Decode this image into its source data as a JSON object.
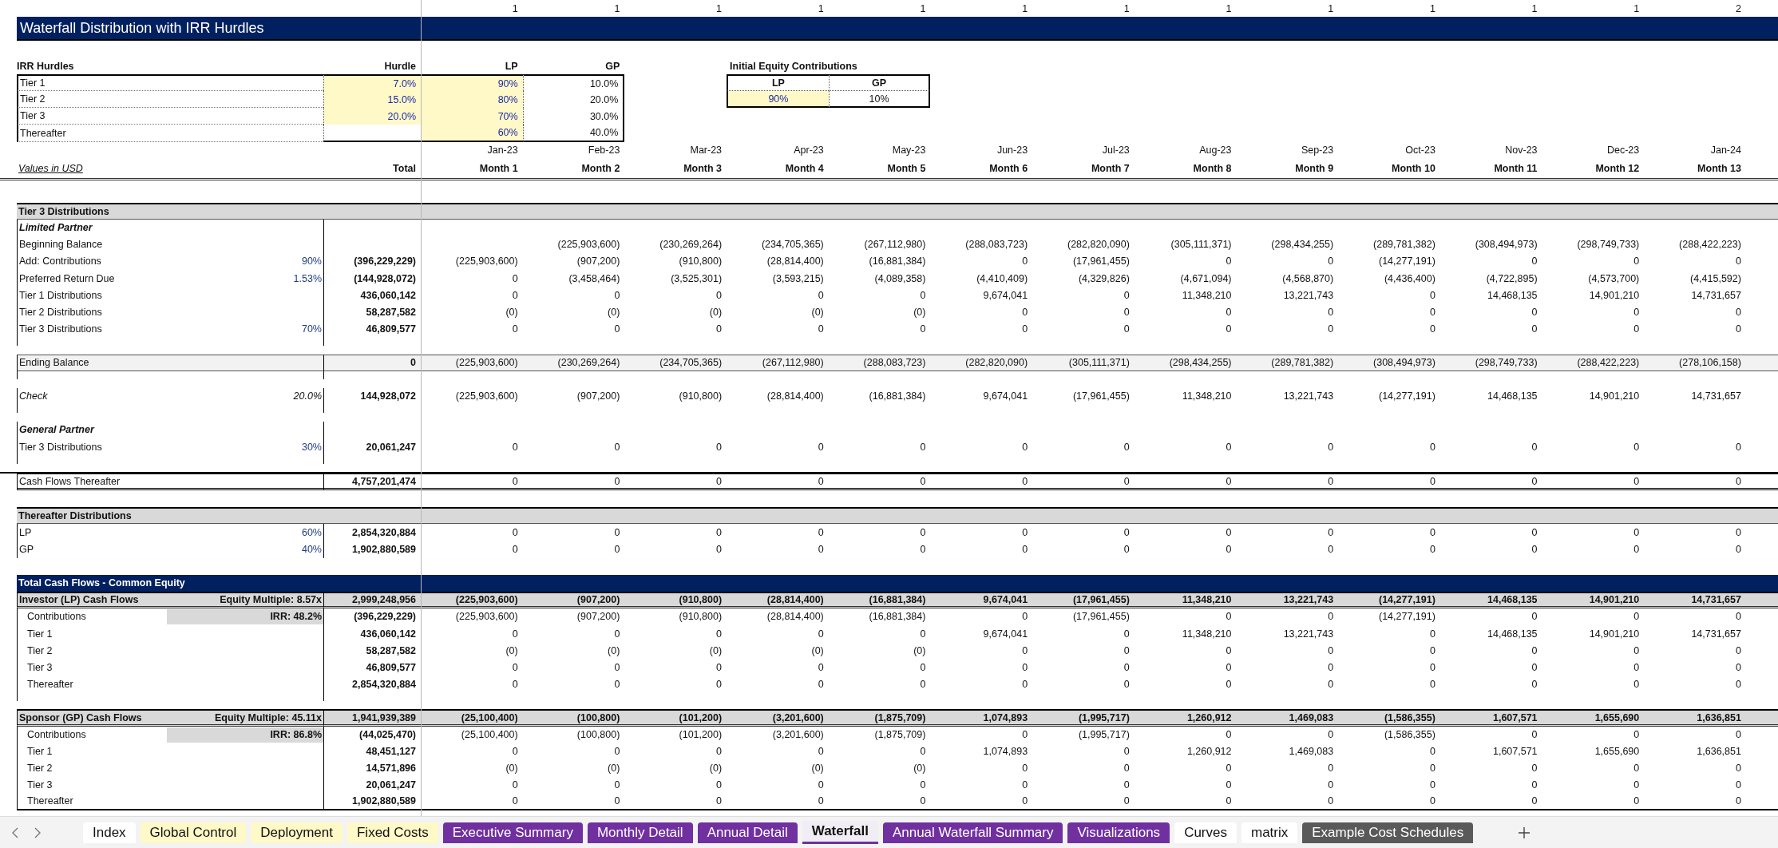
{
  "counters": [
    "1",
    "1",
    "1",
    "1",
    "1",
    "1",
    "1",
    "1",
    "1",
    "1",
    "1",
    "1",
    "2"
  ],
  "title": "Waterfall Distribution with IRR Hurdles",
  "irr_hurdles": {
    "heading": "IRR Hurdles",
    "hurdle_label": "Hurdle",
    "lp_label": "LP",
    "gp_label": "GP",
    "rows": [
      {
        "label": "Tier 1",
        "hurdle": "7.0%",
        "lp": "90%",
        "gp": "10.0%"
      },
      {
        "label": "Tier 2",
        "hurdle": "15.0%",
        "lp": "80%",
        "gp": "20.0%"
      },
      {
        "label": "Tier 3",
        "hurdle": "20.0%",
        "lp": "70%",
        "gp": "30.0%"
      },
      {
        "label": "Thereafter",
        "lp": "60%",
        "gp": "40.0%"
      }
    ]
  },
  "initial_equity": {
    "title": "Initial Equity Contributions",
    "lp_label": "LP",
    "gp_label": "GP",
    "lp": "90%",
    "gp": "10%"
  },
  "dates": [
    "Jan-23",
    "Feb-23",
    "Mar-23",
    "Apr-23",
    "May-23",
    "Jun-23",
    "Jul-23",
    "Aug-23",
    "Sep-23",
    "Oct-23",
    "Nov-23",
    "Dec-23",
    "Jan-24"
  ],
  "units_label": "Values in USD",
  "total_label": "Total",
  "months": [
    "Month 1",
    "Month 2",
    "Month 3",
    "Month 4",
    "Month 5",
    "Month 6",
    "Month 7",
    "Month 8",
    "Month 9",
    "Month 10",
    "Month 11",
    "Month 12",
    "Month 13"
  ],
  "rows": [
    {
      "kind": "section",
      "label": "Tier 3 Distributions"
    },
    {
      "kind": "subhead",
      "label": "Limited Partner"
    },
    {
      "kind": "opening",
      "label": "Beginning Balance",
      "values": [
        "(225,903,600)",
        "(230,269,264)",
        "(234,705,365)",
        "(267,112,980)",
        "(288,083,723)",
        "(282,820,090)",
        "(305,111,371)",
        "(298,434,255)",
        "(289,781,382)",
        "(308,494,973)",
        "(298,749,733)",
        "(288,422,223)"
      ]
    },
    {
      "kind": "line",
      "label": "Add: Contributions",
      "rate": "90%",
      "total": "(396,229,229)",
      "values": [
        "(225,903,600)",
        "(907,200)",
        "(910,800)",
        "(28,814,400)",
        "(16,881,384)",
        "0",
        "(17,961,455)",
        "0",
        "0",
        "(14,277,191)",
        "0",
        "0",
        "0"
      ]
    },
    {
      "kind": "line",
      "label": "Preferred Return Due",
      "rate": "1.53%",
      "total": "(144,928,072)",
      "values": [
        "0",
        "(3,458,464)",
        "(3,525,301)",
        "(3,593,215)",
        "(4,089,358)",
        "(4,410,409)",
        "(4,329,826)",
        "(4,671,094)",
        "(4,568,870)",
        "(4,436,400)",
        "(4,722,895)",
        "(4,573,700)",
        "(4,415,592)"
      ]
    },
    {
      "kind": "line",
      "label": "Tier 1 Distributions",
      "total": "436,060,142",
      "values": [
        "0",
        "0",
        "0",
        "0",
        "0",
        "9,674,041",
        "0",
        "11,348,210",
        "13,221,743",
        "0",
        "14,468,135",
        "14,901,210",
        "14,731,657"
      ]
    },
    {
      "kind": "line",
      "label": "Tier 2 Distributions",
      "total": "58,287,582",
      "values": [
        "(0)",
        "(0)",
        "(0)",
        "(0)",
        "(0)",
        "0",
        "0",
        "0",
        "0",
        "0",
        "0",
        "0",
        "0"
      ]
    },
    {
      "kind": "line",
      "label": "Tier 3 Distributions",
      "rate": "70%",
      "total": "46,809,577",
      "values": [
        "0",
        "0",
        "0",
        "0",
        "0",
        "0",
        "0",
        "0",
        "0",
        "0",
        "0",
        "0",
        "0"
      ]
    },
    {
      "kind": "spacer"
    },
    {
      "kind": "ending",
      "label": "Ending Balance",
      "total": "0",
      "values": [
        "(225,903,600)",
        "(230,269,264)",
        "(234,705,365)",
        "(267,112,980)",
        "(288,083,723)",
        "(282,820,090)",
        "(305,111,371)",
        "(298,434,255)",
        "(289,781,382)",
        "(308,494,973)",
        "(298,749,733)",
        "(288,422,223)",
        "(278,106,158)"
      ]
    },
    {
      "kind": "spacer"
    },
    {
      "kind": "check",
      "label": "Check",
      "rate": "20.0%",
      "total": "144,928,072",
      "values": [
        "(225,903,600)",
        "(907,200)",
        "(910,800)",
        "(28,814,400)",
        "(16,881,384)",
        "9,674,041",
        "(17,961,455)",
        "11,348,210",
        "13,221,743",
        "(14,277,191)",
        "14,468,135",
        "14,901,210",
        "14,731,657"
      ]
    },
    {
      "kind": "spacer"
    },
    {
      "kind": "subhead",
      "label": "General Partner"
    },
    {
      "kind": "line",
      "label": "Tier 3 Distributions",
      "rate": "30%",
      "total": "20,061,247",
      "values": [
        "0",
        "0",
        "0",
        "0",
        "0",
        "0",
        "0",
        "0",
        "0",
        "0",
        "0",
        "0",
        "0"
      ]
    },
    {
      "kind": "rule"
    },
    {
      "kind": "boxed",
      "label": "Cash Flows Thereafter",
      "total": "4,757,201,474",
      "values": [
        "0",
        "0",
        "0",
        "0",
        "0",
        "0",
        "0",
        "0",
        "0",
        "0",
        "0",
        "0",
        "0"
      ]
    },
    {
      "kind": "gap"
    },
    {
      "kind": "section",
      "label": "Thereafter Distributions"
    },
    {
      "kind": "line",
      "label": "LP",
      "rate": "60%",
      "total": "2,854,320,884",
      "values": [
        "0",
        "0",
        "0",
        "0",
        "0",
        "0",
        "0",
        "0",
        "0",
        "0",
        "0",
        "0",
        "0"
      ]
    },
    {
      "kind": "line",
      "label": "GP",
      "rate": "40%",
      "total": "1,902,880,589",
      "values": [
        "0",
        "0",
        "0",
        "0",
        "0",
        "0",
        "0",
        "0",
        "0",
        "0",
        "0",
        "0",
        "0"
      ]
    },
    {
      "kind": "gap"
    },
    {
      "kind": "banner",
      "label": "Total Cash Flows - Common Equity"
    },
    {
      "kind": "summary",
      "label": "Investor (LP) Cash Flows",
      "rate": "Equity Multiple: 8.57x",
      "total": "2,999,248,956",
      "values": [
        "(225,903,600)",
        "(907,200)",
        "(910,800)",
        "(28,814,400)",
        "(16,881,384)",
        "9,674,041",
        "(17,961,455)",
        "11,348,210",
        "13,221,743",
        "(14,277,191)",
        "14,468,135",
        "14,901,210",
        "14,731,657"
      ]
    },
    {
      "kind": "detail",
      "label": "Contributions",
      "rate": "IRR: 48.2%",
      "total": "(396,229,229)",
      "values": [
        "(225,903,600)",
        "(907,200)",
        "(910,800)",
        "(28,814,400)",
        "(16,881,384)",
        "0",
        "(17,961,455)",
        "0",
        "0",
        "(14,277,191)",
        "0",
        "0",
        "0"
      ]
    },
    {
      "kind": "detail",
      "label": "Tier 1",
      "total": "436,060,142",
      "values": [
        "0",
        "0",
        "0",
        "0",
        "0",
        "9,674,041",
        "0",
        "11,348,210",
        "13,221,743",
        "0",
        "14,468,135",
        "14,901,210",
        "14,731,657"
      ]
    },
    {
      "kind": "detail",
      "label": "Tier 2",
      "total": "58,287,582",
      "values": [
        "(0)",
        "(0)",
        "(0)",
        "(0)",
        "(0)",
        "0",
        "0",
        "0",
        "0",
        "0",
        "0",
        "0",
        "0"
      ]
    },
    {
      "kind": "detail",
      "label": "Tier 3",
      "total": "46,809,577",
      "values": [
        "0",
        "0",
        "0",
        "0",
        "0",
        "0",
        "0",
        "0",
        "0",
        "0",
        "0",
        "0",
        "0"
      ]
    },
    {
      "kind": "detail",
      "label": "Thereafter",
      "total": "2,854,320,884",
      "values": [
        "0",
        "0",
        "0",
        "0",
        "0",
        "0",
        "0",
        "0",
        "0",
        "0",
        "0",
        "0",
        "0"
      ]
    },
    {
      "kind": "spacer"
    },
    {
      "kind": "summary",
      "label": "Sponsor (GP) Cash Flows",
      "rate": "Equity Multiple: 45.11x",
      "total": "1,941,939,389",
      "values": [
        "(25,100,400)",
        "(100,800)",
        "(101,200)",
        "(3,201,600)",
        "(1,875,709)",
        "1,074,893",
        "(1,995,717)",
        "1,260,912",
        "1,469,083",
        "(1,586,355)",
        "1,607,571",
        "1,655,690",
        "1,636,851"
      ]
    },
    {
      "kind": "detail",
      "label": "Contributions",
      "rate": "IRR: 86.8%",
      "total": "(44,025,470)",
      "values": [
        "(25,100,400)",
        "(100,800)",
        "(101,200)",
        "(3,201,600)",
        "(1,875,709)",
        "0",
        "(1,995,717)",
        "0",
        "0",
        "(1,586,355)",
        "0",
        "0",
        "0"
      ]
    },
    {
      "kind": "detail",
      "label": "Tier 1",
      "total": "48,451,127",
      "values": [
        "0",
        "0",
        "0",
        "0",
        "0",
        "1,074,893",
        "0",
        "1,260,912",
        "1,469,083",
        "0",
        "1,607,571",
        "1,655,690",
        "1,636,851"
      ]
    },
    {
      "kind": "detail",
      "label": "Tier 2",
      "total": "14,571,896",
      "values": [
        "(0)",
        "(0)",
        "(0)",
        "(0)",
        "(0)",
        "0",
        "0",
        "0",
        "0",
        "0",
        "0",
        "0",
        "0"
      ]
    },
    {
      "kind": "detail",
      "label": "Tier 3",
      "total": "20,061,247",
      "values": [
        "0",
        "0",
        "0",
        "0",
        "0",
        "0",
        "0",
        "0",
        "0",
        "0",
        "0",
        "0",
        "0"
      ]
    },
    {
      "kind": "detail",
      "label": "Thereafter",
      "total": "1,902,880,589",
      "values": [
        "0",
        "0",
        "0",
        "0",
        "0",
        "0",
        "0",
        "0",
        "0",
        "0",
        "0",
        "0",
        "0"
      ]
    }
  ],
  "tabs": [
    {
      "label": "Index",
      "color": "#ffffff",
      "selected": false
    },
    {
      "label": "Global Control",
      "color": "#fff9c8",
      "selected": false
    },
    {
      "label": "Deployment",
      "color": "#fff9c8",
      "selected": false
    },
    {
      "label": "Fixed Costs",
      "color": "#fff9c8",
      "selected": false
    },
    {
      "label": "Executive Summary",
      "color": "#7030a0",
      "selected": false
    },
    {
      "label": "Monthly Detail",
      "color": "#7030a0",
      "selected": false
    },
    {
      "label": "Annual Detail",
      "color": "#7030a0",
      "selected": false
    },
    {
      "label": "Waterfall",
      "color": "#7030a0",
      "selected": true
    },
    {
      "label": "Annual Waterfall Summary",
      "color": "#7030a0",
      "selected": false
    },
    {
      "label": "Visualizations",
      "color": "#7030a0",
      "selected": false
    },
    {
      "label": "Curves",
      "color": "#ffffff",
      "selected": false
    },
    {
      "label": "matrix",
      "color": "#ffffff",
      "selected": false
    },
    {
      "label": "Example Cost Schedules",
      "color": "#595959",
      "selected": false
    }
  ]
}
